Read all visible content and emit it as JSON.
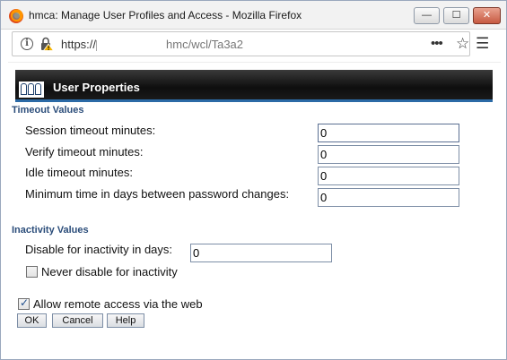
{
  "window": {
    "title": "hmca: Manage User Profiles and Access - Mozilla Firefox",
    "minimize_label": "—",
    "maximize_label": "☐",
    "close_label": "✕"
  },
  "urlbar": {
    "scheme": "https://",
    "path": "hmc/wcl/Ta3a2"
  },
  "page": {
    "header_title": "User Properties",
    "timeout_section": {
      "title": "Timeout Values",
      "session_label": "Session timeout minutes:",
      "session_value": "0",
      "verify_label": "Verify timeout minutes:",
      "verify_value": "0",
      "idle_label": "Idle timeout minutes:",
      "idle_value": "0",
      "min_days_label": "Minimum time in days between password changes:",
      "min_days_value": "0"
    },
    "inactivity_section": {
      "title": "Inactivity Values",
      "disable_label": "Disable for inactivity in days:",
      "disable_value": "0",
      "never_disable_label": "Never disable for inactivity",
      "never_disable_checked": false
    },
    "remote_access_label": "Allow remote access via the web",
    "remote_access_checked": true,
    "buttons": {
      "ok": "OK",
      "cancel": "Cancel",
      "help": "Help"
    }
  }
}
